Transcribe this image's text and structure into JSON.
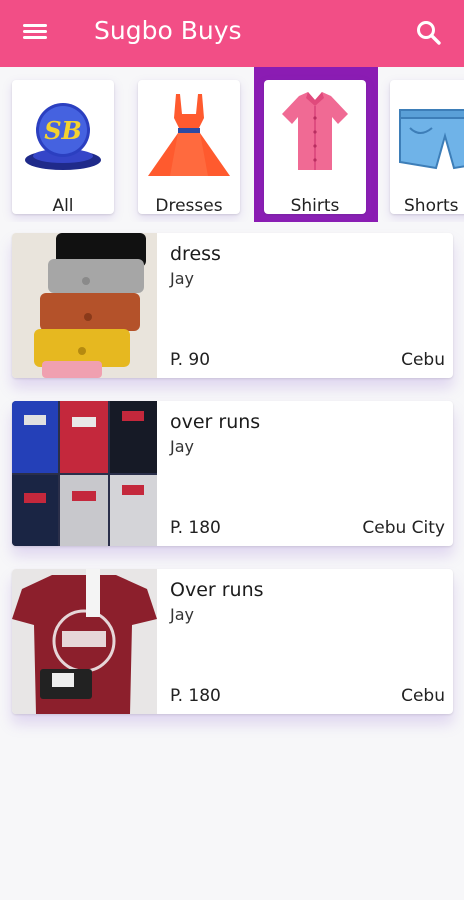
{
  "appbar": {
    "title": "Sugbo Buys",
    "menu_icon": "hamburger-menu-icon",
    "search_icon": "search-icon",
    "background": "#f24e86"
  },
  "categories": [
    {
      "label": "All",
      "icon": "sb-logo-icon",
      "badge_text": "SB"
    },
    {
      "label": "Dresses",
      "icon": "dress-icon"
    },
    {
      "label": "Shirts",
      "icon": "shirt-icon",
      "selected": true
    },
    {
      "label": "Shorts",
      "icon": "shorts-icon"
    }
  ],
  "selected_category_color": "#8b1cb3",
  "products": [
    {
      "name": "dress",
      "seller": "Jay",
      "price": "P. 90",
      "location": "Cebu",
      "thumbnail": "stacked-shorts-photo"
    },
    {
      "name": "over runs",
      "seller": "Jay",
      "price": "P. 180",
      "location": "Cebu City",
      "thumbnail": "levis-shirts-grid-photo"
    },
    {
      "name": "Over runs",
      "seller": "Jay",
      "price": "P. 180",
      "location": "Cebu",
      "thumbnail": "maroon-printed-shirt-photo"
    }
  ]
}
